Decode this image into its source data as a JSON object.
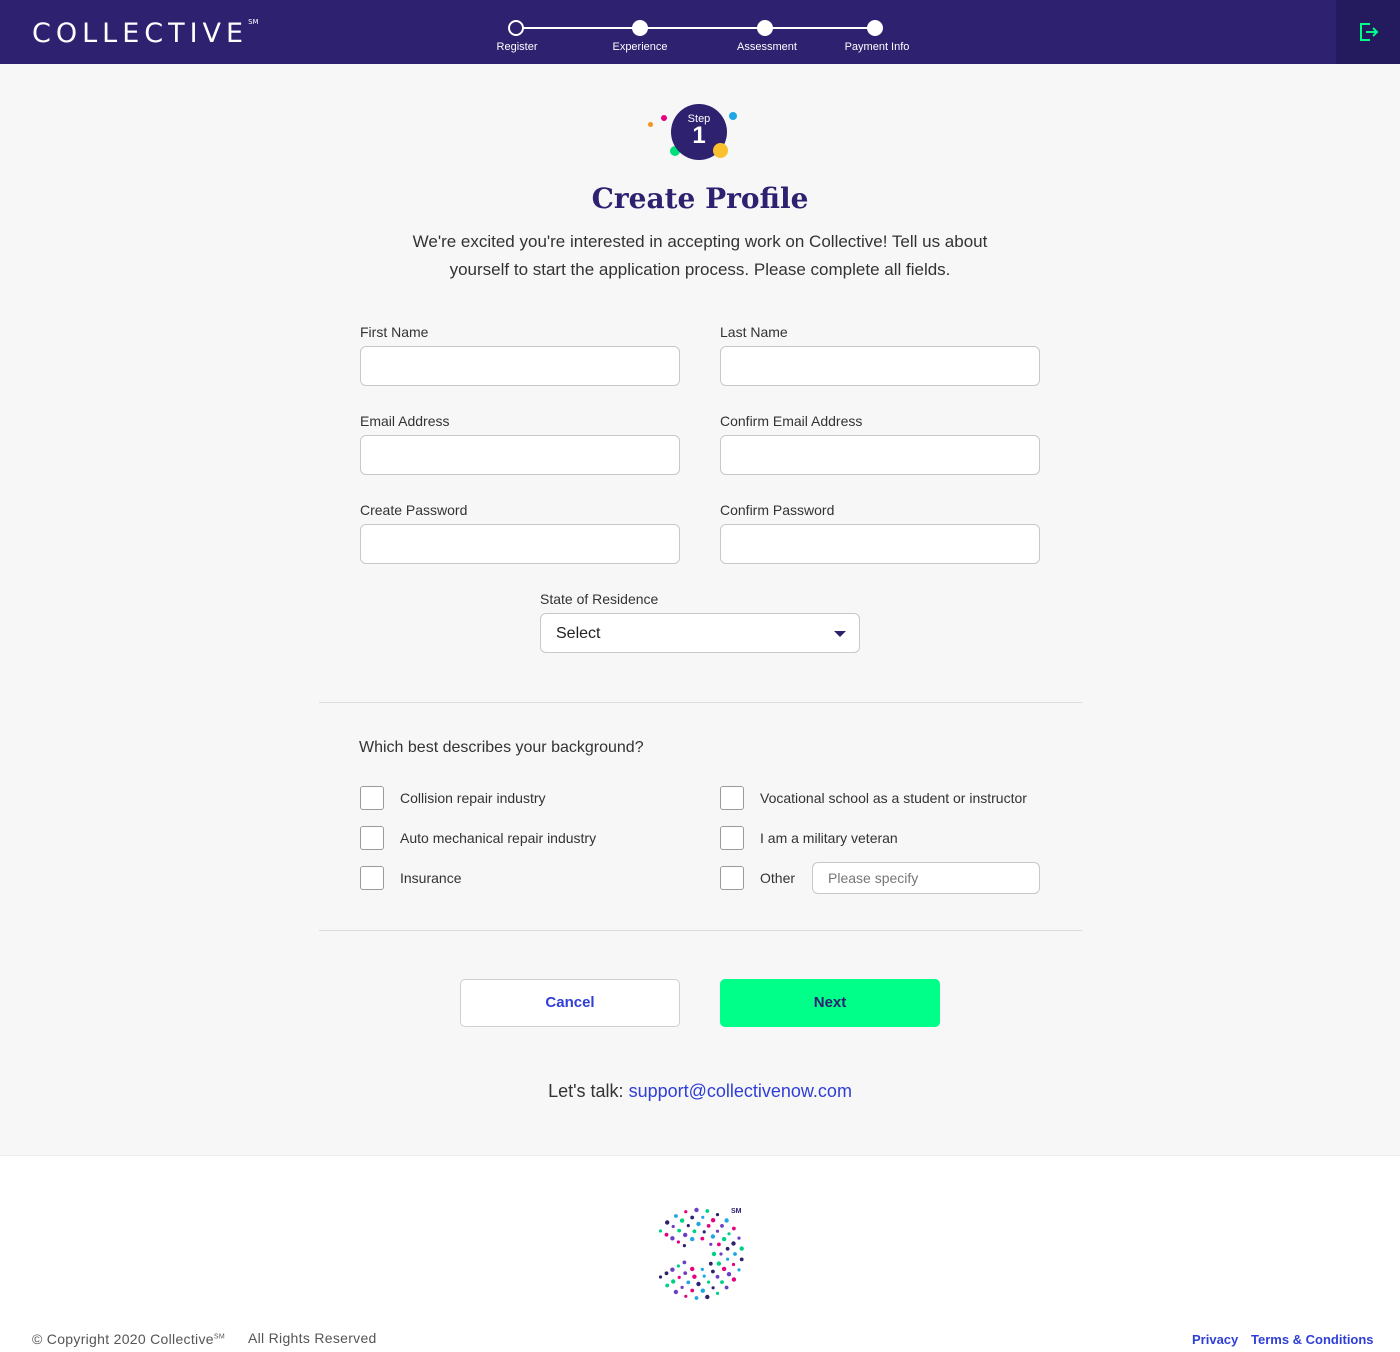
{
  "brand": {
    "logo_text": "COLLECTIVE",
    "logo_mark": "SM"
  },
  "stepper": {
    "steps": [
      {
        "label": "Register",
        "state": "current"
      },
      {
        "label": "Experience",
        "state": "upcoming"
      },
      {
        "label": "Assessment",
        "state": "upcoming"
      },
      {
        "label": "Payment Info",
        "state": "upcoming"
      }
    ]
  },
  "header": {
    "exit_icon": "logout-icon"
  },
  "badge": {
    "step_word": "Step",
    "step_number": "1"
  },
  "page": {
    "title": "Create Profile",
    "intro": "We're excited you're interested in accepting work on Collective! Tell us about yourself to start the application process. Please complete all fields."
  },
  "form": {
    "first_name": {
      "label": "First Name",
      "value": ""
    },
    "last_name": {
      "label": "Last Name",
      "value": ""
    },
    "email": {
      "label": "Email Address",
      "value": ""
    },
    "confirm_email": {
      "label": "Confirm Email Address",
      "value": ""
    },
    "password": {
      "label": "Create Password",
      "value": ""
    },
    "confirm_password": {
      "label": "Confirm Password",
      "value": ""
    },
    "state": {
      "label": "State of Residence",
      "selected": "Select"
    }
  },
  "background": {
    "question": "Which best describes your background?",
    "options": [
      {
        "label": "Collision repair industry",
        "checked": false
      },
      {
        "label": "Auto mechanical repair industry",
        "checked": false
      },
      {
        "label": "Insurance",
        "checked": false
      },
      {
        "label": "Vocational school as a student or instructor",
        "checked": false
      },
      {
        "label": "I am a military veteran",
        "checked": false
      },
      {
        "label": "Other",
        "checked": false
      }
    ],
    "other_placeholder": "Please specify"
  },
  "actions": {
    "cancel_label": "Cancel",
    "next_label": "Next"
  },
  "contact": {
    "prefix": "Let's talk:",
    "email": "support@collectivenow.com"
  },
  "footer": {
    "copyright": "© Copyright 2020 Collective",
    "copyright_mark": "SM",
    "logo_mark": "SM",
    "rights": "All Rights Reserved",
    "privacy_label": "Privacy",
    "terms_label": "Terms & Conditions"
  },
  "colors": {
    "primary": "#2d2170",
    "accent_green": "#00ff88",
    "link_blue": "#2f3ed6"
  }
}
